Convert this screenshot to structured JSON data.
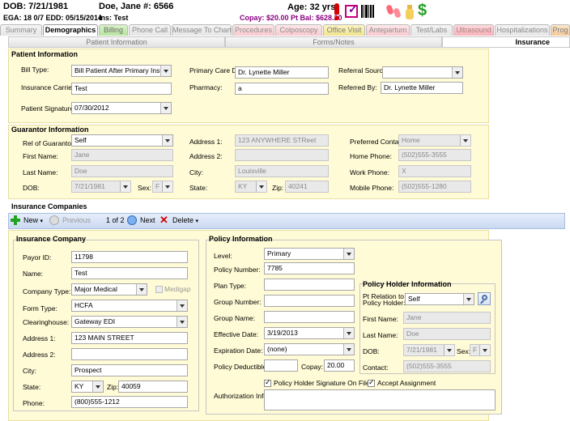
{
  "header": {
    "dob": "DOB: 7/21/1981",
    "name": "Doe, Jane #: 6566",
    "age": "Age: 32 yrs",
    "ega": "EGA: 18 0/7 EDD: 05/15/2014",
    "ins": "Ins: Test",
    "copay": "Copay: $20.00 Pt Bal: $628.20"
  },
  "tabs": [
    "Summary",
    "Demographics",
    "Billing",
    "Phone Call",
    "Message To Chart",
    "Procedures",
    "Colposcopy",
    "Office Visit",
    "Antepartum",
    "Test/Labs",
    "Ultrasound",
    "Hospitalizations",
    "Prog"
  ],
  "subtabs": [
    "Patient Information",
    "Forms/Notes",
    "Insurance"
  ],
  "patient_info": {
    "title": "Patient Information",
    "bill_type_label": "Bill Type:",
    "bill_type": "Bill Patient After Primary Insura",
    "carrier_label": "Insurance Carrier:",
    "carrier": "Test",
    "signature_label": "Patient Signature:",
    "signature": "07/30/2012",
    "pcp_label": "Primary Care Dr:",
    "pcp": "Dr. Lynette Miller",
    "pharmacy_label": "Pharmacy:",
    "pharmacy": "a",
    "referral_label": "Referral Source",
    "referral": "",
    "referred_by_label": "Referred By:",
    "referred_by": "Dr. Lynette Miller"
  },
  "guarantor": {
    "title": "Guarantor Information",
    "rel_label": "Rel of Guarantor:",
    "rel": "Self",
    "first_label": "First Name:",
    "first": "Jane",
    "last_label": "Last Name:",
    "last": "Doe",
    "dob_label": "DOB:",
    "dob": "7/21/1981",
    "sex_label": "Sex:",
    "sex": "F",
    "addr1_label": "Address 1:",
    "addr1": "123 ANYWHERE STReet",
    "addr2_label": "Address 2:",
    "addr2": "",
    "city_label": "City:",
    "city": "Louisville",
    "state_label": "State:",
    "state": "KY",
    "zip_label": "Zip:",
    "zip": "40241",
    "contact_label": "Preferred Contact:",
    "contact": "Home",
    "home_label": "Home Phone:",
    "home": "(502)555-3555",
    "work_label": "Work Phone:",
    "work": "X",
    "mobile_label": "Mobile Phone:",
    "mobile": "(502)555-1280"
  },
  "insurance": {
    "title": "Insurance Companies",
    "toolbar": {
      "new": "New",
      "previous": "Previous",
      "page": "1 of 2",
      "next": "Next",
      "delete": "Delete"
    },
    "company": {
      "title": "Insurance Company",
      "payor_label": "Payor ID:",
      "payor": "11798",
      "name_label": "Name:",
      "name": "Test",
      "type_label": "Company Type:",
      "type": "Major Medical",
      "medigap_label": "Medigap",
      "form_label": "Form Type:",
      "form": "HCFA",
      "clearing_label": "Clearinghouse:",
      "clearing": "Gateway EDI",
      "addr1_label": "Address 1:",
      "addr1": "123 MAIN STREET",
      "addr2_label": "Address 2:",
      "addr2": "",
      "city_label": "City:",
      "city": "Prospect",
      "state_label": "State:",
      "state": "KY",
      "zip_label": "Zip:",
      "zip": "40059",
      "phone_label": "Phone:",
      "phone": "(800)555-1212"
    },
    "policy": {
      "title": "Policy Information",
      "level_label": "Level:",
      "level": "Primary",
      "number_label": "Policy Number:",
      "number": "7785",
      "plan_label": "Plan Type:",
      "plan": "",
      "group_num_label": "Group Number:",
      "group_num": "",
      "group_name_label": "Group Name:",
      "group_name": "",
      "effective_label": "Effective Date:",
      "effective": "3/19/2013",
      "expiration_label": "Expiration Date:",
      "expiration": "(none)",
      "deductible_label": "Policy Deductible:",
      "deductible": "",
      "copay_label": "Copay:",
      "copay": "20.00",
      "sig_label": "Policy Holder Signature On File",
      "accept_label": "Accept Assignment",
      "auth_label": "Authorization Info:",
      "auth": ""
    },
    "holder": {
      "title": "Policy Holder Information",
      "relation_label1": "Pt Relation to",
      "relation_label2": "Policy Holder:",
      "relation": "Self",
      "first_label": "First Name:",
      "first": "Jane",
      "last_label": "Last Name:",
      "last": "Doe",
      "dob_label": "DOB:",
      "dob": "7/21/1981",
      "sex_label": "Sex:",
      "sex": "F",
      "contact_label": "Contact:",
      "contact": "(502)555-3555"
    }
  },
  "colors": {
    "panel": "#fffbd6",
    "accent_blue": "#cad9f1",
    "alert_red": "#d40000",
    "copay_purple": "#8b0080"
  }
}
